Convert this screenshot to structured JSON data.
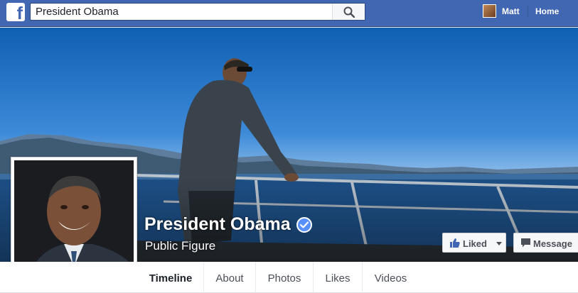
{
  "header": {
    "logo_letter": "f",
    "search_value": "President Obama",
    "user_name": "Matt",
    "home_label": "Home"
  },
  "icons": {
    "logo": "facebook-logo-icon",
    "search": "search-icon",
    "verified": "verified-badge-icon",
    "like": "thumbs-up-icon",
    "message": "message-bubble-icon"
  },
  "profile": {
    "name": "President Obama",
    "category": "Public Figure",
    "verified": true
  },
  "actions": {
    "liked_label": "Liked",
    "message_label": "Message"
  },
  "tabs": [
    {
      "label": "Timeline",
      "active": true
    },
    {
      "label": "About",
      "active": false
    },
    {
      "label": "Photos",
      "active": false
    },
    {
      "label": "Likes",
      "active": false
    },
    {
      "label": "Videos",
      "active": false
    }
  ],
  "colors": {
    "brand": "#4267b2",
    "verified": "#5890ff"
  }
}
